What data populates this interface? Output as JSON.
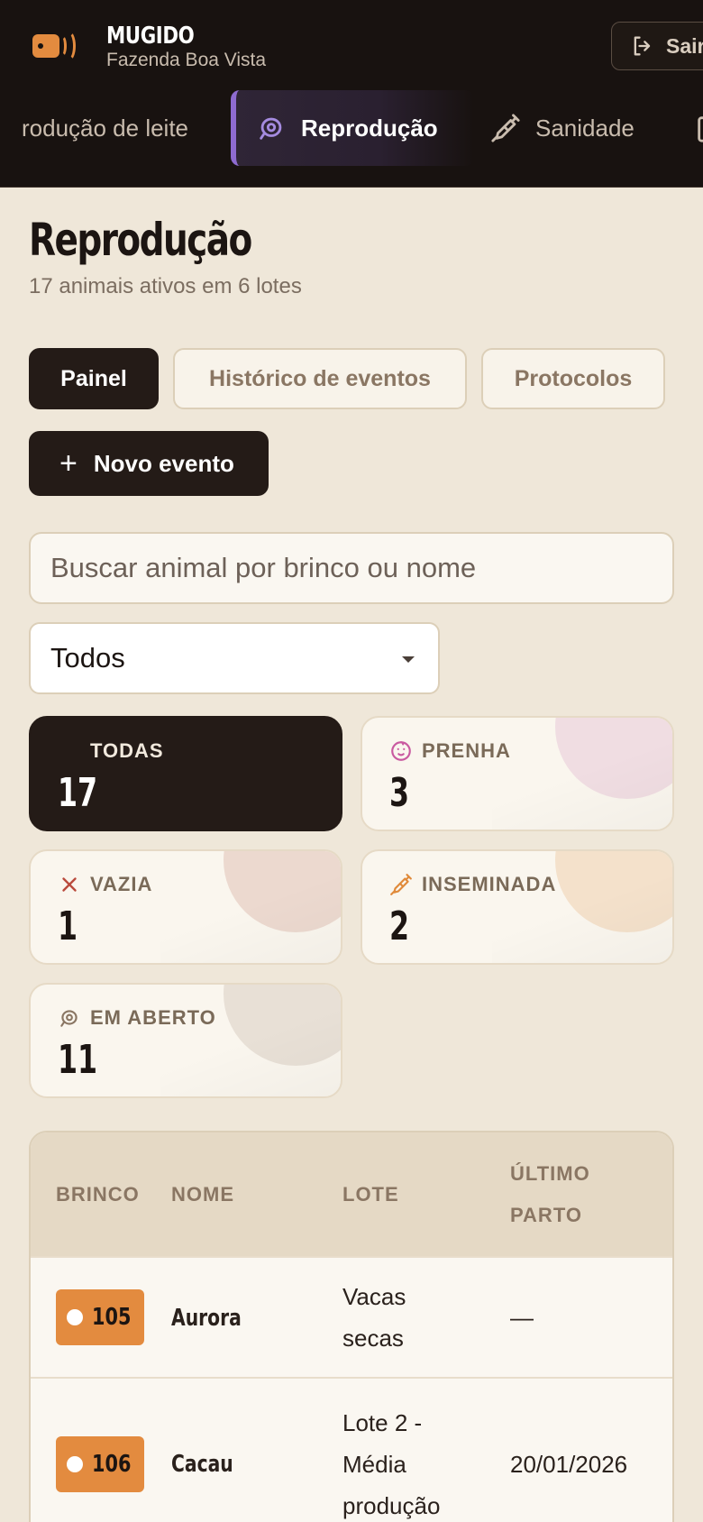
{
  "app": {
    "name": "MUGIDO",
    "farm": "Fazenda Boa Vista",
    "logout_label": "Sair"
  },
  "nav": {
    "items": [
      {
        "label": "rodução de leite",
        "icon": "milk-icon",
        "active": false
      },
      {
        "label": "Reprodução",
        "icon": "uterus-icon",
        "active": true
      },
      {
        "label": "Sanidade",
        "icon": "syringe-icon",
        "active": false
      }
    ]
  },
  "page": {
    "title": "Reprodução",
    "subtitle": "17 animais ativos em 6 lotes"
  },
  "tabs": [
    {
      "label": "Painel",
      "active": true
    },
    {
      "label": "Histórico de eventos",
      "active": false
    },
    {
      "label": "Protocolos",
      "active": false
    }
  ],
  "actions": {
    "new_event_label": "Novo evento"
  },
  "search": {
    "placeholder": "Buscar animal por brinco ou nome",
    "value": ""
  },
  "filter": {
    "selected": "Todos"
  },
  "stats": [
    {
      "label": "TODAS",
      "value": "17",
      "icon": "",
      "accent": "#241b17"
    },
    {
      "label": "PRENHA",
      "value": "3",
      "icon": "baby-icon",
      "accent": "#c95aa0"
    },
    {
      "label": "VAZIA",
      "value": "1",
      "icon": "x-icon",
      "accent": "#b94a3c"
    },
    {
      "label": "INSEMINADA",
      "value": "2",
      "icon": "syringe-icon",
      "accent": "#e08a3a"
    },
    {
      "label": "EM ABERTO",
      "value": "11",
      "icon": "uterus-icon",
      "accent": "#8a7663"
    }
  ],
  "table": {
    "headers": {
      "brinco": "BRINCO",
      "nome": "NOME",
      "lote": "LOTE",
      "ultimo_parto_1": "ÚLTIMO",
      "ultimo_parto_2": "PARTO"
    },
    "rows": [
      {
        "brinco": "105",
        "nome": "Aurora",
        "lote_1": "Vacas",
        "lote_2": "secas",
        "lote_3": "",
        "ultimo_parto": "—"
      },
      {
        "brinco": "106",
        "nome": "Cacau",
        "lote_1": "Lote 2 -",
        "lote_2": "Média",
        "lote_3": "produção",
        "ultimo_parto": "20/01/2026"
      }
    ]
  },
  "colors": {
    "accent_orange": "#e38b3f",
    "accent_purple": "#8e6bd0",
    "dark": "#241b17",
    "background": "#efe7d9"
  }
}
